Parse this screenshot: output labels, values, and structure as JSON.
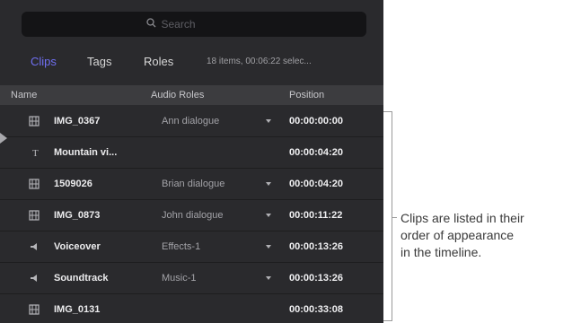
{
  "search": {
    "placeholder": "Search",
    "icon": "magnifying-glass"
  },
  "tabs": [
    {
      "label": "Clips",
      "active": true
    },
    {
      "label": "Tags",
      "active": false
    },
    {
      "label": "Roles",
      "active": false
    }
  ],
  "summary": "18 items, 00:06:22 selec...",
  "columns": {
    "name": "Name",
    "audio_roles": "Audio Roles",
    "position": "Position"
  },
  "rows": [
    {
      "icon": "film-strip-icon",
      "name": "IMG_0367",
      "role": "Ann dialogue",
      "has_dropdown": true,
      "position": "00:00:00:00"
    },
    {
      "icon": "title-icon",
      "name": "Mountain vi...",
      "role": "",
      "has_dropdown": false,
      "position": "00:00:04:20"
    },
    {
      "icon": "film-strip-icon",
      "name": "1509026",
      "role": "Brian dialogue",
      "has_dropdown": true,
      "position": "00:00:04:20"
    },
    {
      "icon": "film-strip-icon",
      "name": "IMG_0873",
      "role": "John dialogue",
      "has_dropdown": true,
      "position": "00:00:11:22"
    },
    {
      "icon": "speaker-icon",
      "name": "Voiceover",
      "role": "Effects-1",
      "has_dropdown": true,
      "position": "00:00:13:26"
    },
    {
      "icon": "speaker-icon",
      "name": "Soundtrack",
      "role": "Music-1",
      "has_dropdown": true,
      "position": "00:00:13:26"
    },
    {
      "icon": "film-strip-icon",
      "name": "IMG_0131",
      "role": "",
      "has_dropdown": false,
      "position": "00:00:33:08"
    }
  ],
  "callout": {
    "lines": [
      "Clips are listed in their",
      "order of appearance",
      "in the timeline."
    ]
  },
  "colors": {
    "panel": "#2a2a2d",
    "accent": "#6f6ff2",
    "header": "#3c3c3f"
  }
}
